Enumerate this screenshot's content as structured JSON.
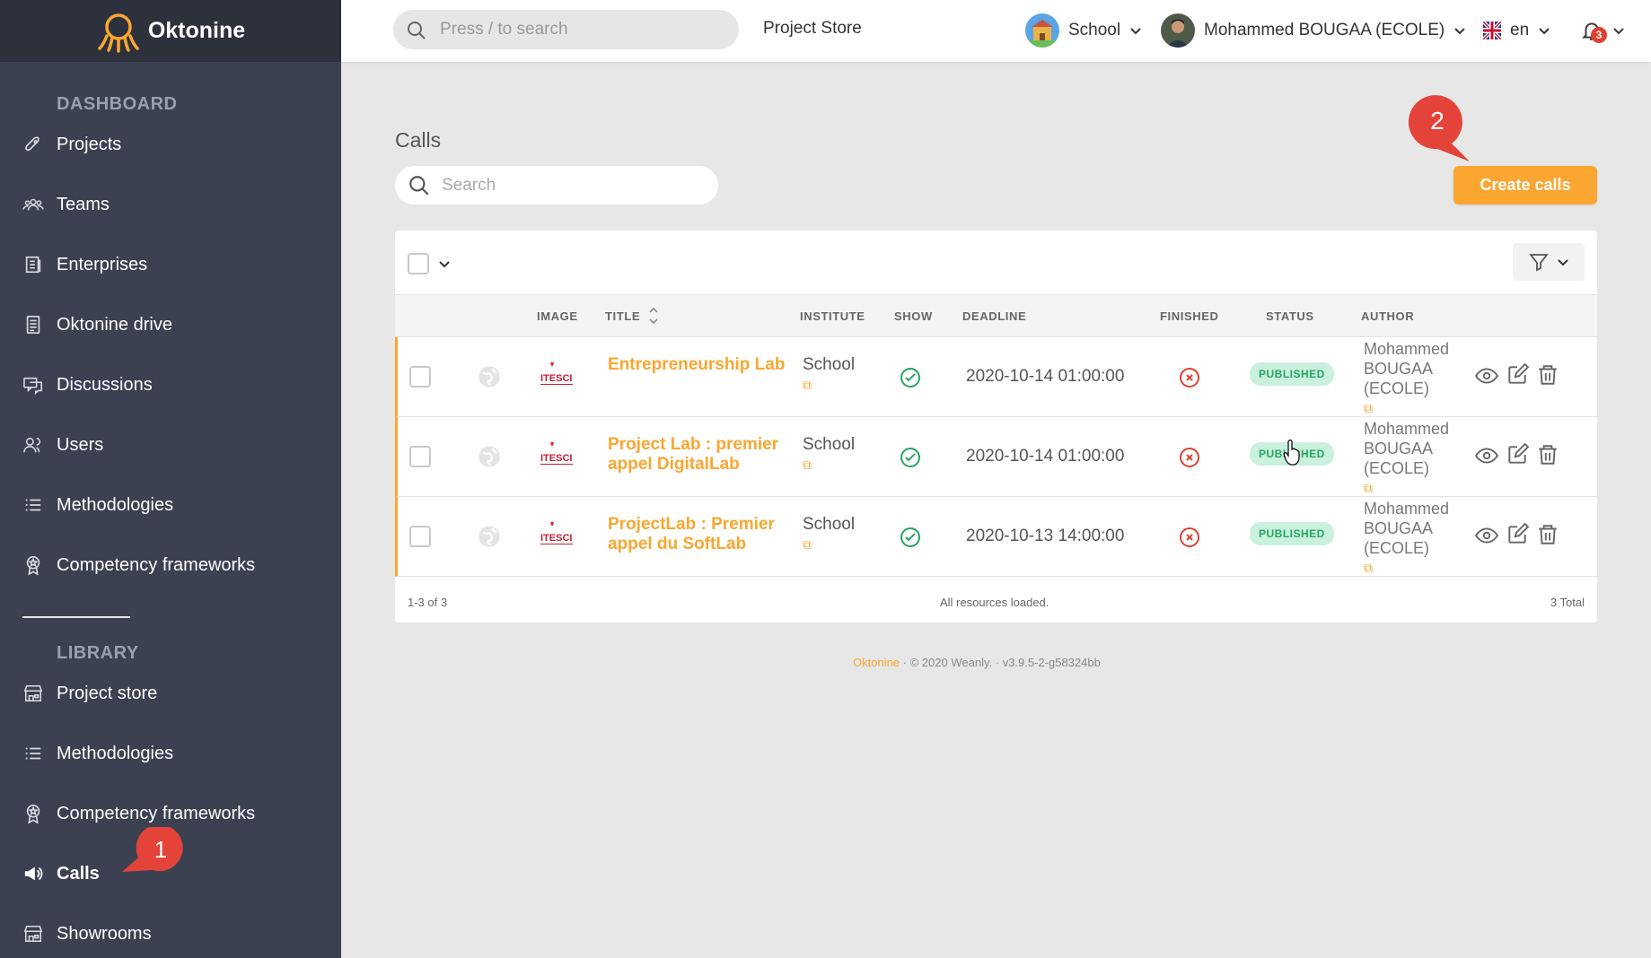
{
  "brand": {
    "name": "Oktonine"
  },
  "sidebar": {
    "dashboard_heading": "DASHBOARD",
    "library_heading": "LIBRARY",
    "dashboard_items": [
      {
        "label": "Projects",
        "icon": "rocket-icon"
      },
      {
        "label": "Teams",
        "icon": "team-icon"
      },
      {
        "label": "Enterprises",
        "icon": "building-icon"
      },
      {
        "label": "Oktonine drive",
        "icon": "drive-icon"
      },
      {
        "label": "Discussions",
        "icon": "chat-icon"
      },
      {
        "label": "Users",
        "icon": "users-icon"
      },
      {
        "label": "Methodologies",
        "icon": "list-icon"
      },
      {
        "label": "Competency frameworks",
        "icon": "badge-icon"
      }
    ],
    "library_items": [
      {
        "label": "Project store",
        "icon": "store-icon"
      },
      {
        "label": "Methodologies",
        "icon": "list-icon"
      },
      {
        "label": "Competency frameworks",
        "icon": "badge-icon"
      },
      {
        "label": "Calls",
        "icon": "megaphone-icon",
        "active": true
      },
      {
        "label": "Showrooms",
        "icon": "store-icon"
      }
    ]
  },
  "topbar": {
    "search_placeholder": "Press / to search",
    "project_store": "Project Store",
    "school": "School",
    "user": "Mohammed BOUGAA (ECOLE)",
    "language": "en",
    "notifications_count": "3"
  },
  "main": {
    "title": "Calls",
    "search_placeholder": "Search",
    "create_button": "Create calls",
    "columns": {
      "image": "IMAGE",
      "title": "TITLE",
      "institute": "INSTITUTE",
      "show": "SHOW",
      "deadline": "DEADLINE",
      "finished": "FINISHED",
      "status": "STATUS",
      "author": "AUTHOR"
    },
    "rows": [
      {
        "image_text": "ITESCI",
        "title": "Entrepreneurship Lab",
        "institute": "School",
        "deadline": "2020-10-14 01:00:00",
        "status": "PUBLISHED",
        "author": "Mohammed BOUGAA (ECOLE)"
      },
      {
        "image_text": "ITESCI",
        "title": "Project Lab : premier appel DigitalLab",
        "institute": "School",
        "deadline": "2020-10-14 01:00:00",
        "status": "PUBLISHED",
        "author": "Mohammed BOUGAA (ECOLE)"
      },
      {
        "image_text": "ITESCI",
        "title": "ProjectLab : Premier appel du SoftLab",
        "institute": "School",
        "deadline": "2020-10-13 14:00:00",
        "status": "PUBLISHED",
        "author": "Mohammed BOUGAA (ECOLE)"
      }
    ],
    "footer_range": "1-3 of 3",
    "footer_status": "All resources loaded.",
    "footer_total": "3 Total"
  },
  "page_footer": {
    "brand": "Oktonine",
    "copyright": "© 2020 Weanly.",
    "version": "v3.9.5-2-g58324bb"
  },
  "annotations": {
    "pin1": "1",
    "pin2": "2"
  },
  "colors": {
    "accent": "#fba630",
    "sidebar": "#3b4150",
    "success": "#27a463",
    "danger": "#e0412f"
  }
}
